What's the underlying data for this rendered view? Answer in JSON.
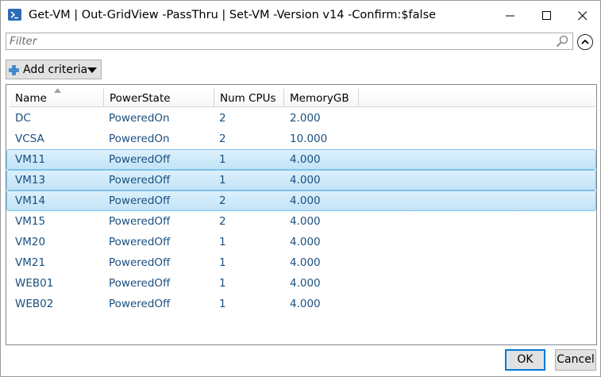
{
  "window": {
    "title": "Get-VM | Out-GridView -PassThru | Set-VM -Version v14 -Confirm:$false",
    "app_icon": "powershell-icon",
    "controls": [
      "minimize-icon",
      "maximize-icon",
      "close-icon"
    ]
  },
  "filter": {
    "placeholder": "Filter",
    "value": "",
    "search_icon": "search-icon",
    "collapse_icon": "chevron-up-icon"
  },
  "criteria": {
    "label": "Add criteria",
    "icon": "plus-icon"
  },
  "grid": {
    "columns": [
      "Name",
      "PowerState",
      "Num CPUs",
      "MemoryGB"
    ],
    "sort_column": "Name",
    "sort_direction": "ascending",
    "rows": [
      {
        "cells": [
          "DC",
          "PoweredOn",
          "2",
          "2.000"
        ],
        "selected": false
      },
      {
        "cells": [
          "VCSA",
          "PoweredOn",
          "2",
          "10.000"
        ],
        "selected": false
      },
      {
        "cells": [
          "VM11",
          "PoweredOff",
          "1",
          "4.000"
        ],
        "selected": true
      },
      {
        "cells": [
          "VM13",
          "PoweredOff",
          "1",
          "4.000"
        ],
        "selected": true
      },
      {
        "cells": [
          "VM14",
          "PoweredOff",
          "2",
          "4.000"
        ],
        "selected": true
      },
      {
        "cells": [
          "VM15",
          "PoweredOff",
          "2",
          "4.000"
        ],
        "selected": false
      },
      {
        "cells": [
          "VM20",
          "PoweredOff",
          "1",
          "4.000"
        ],
        "selected": false
      },
      {
        "cells": [
          "VM21",
          "PoweredOff",
          "1",
          "4.000"
        ],
        "selected": false
      },
      {
        "cells": [
          "WEB01",
          "PoweredOff",
          "1",
          "4.000"
        ],
        "selected": false
      },
      {
        "cells": [
          "WEB02",
          "PoweredOff",
          "1",
          "4.000"
        ],
        "selected": false
      }
    ]
  },
  "buttons": {
    "ok": "OK",
    "cancel": "Cancel"
  },
  "colors": {
    "selection_fill": "#cde8f8",
    "selection_border": "#7fc3ec",
    "cell_text": "#1a4f7f",
    "accent": "#0078d7"
  }
}
